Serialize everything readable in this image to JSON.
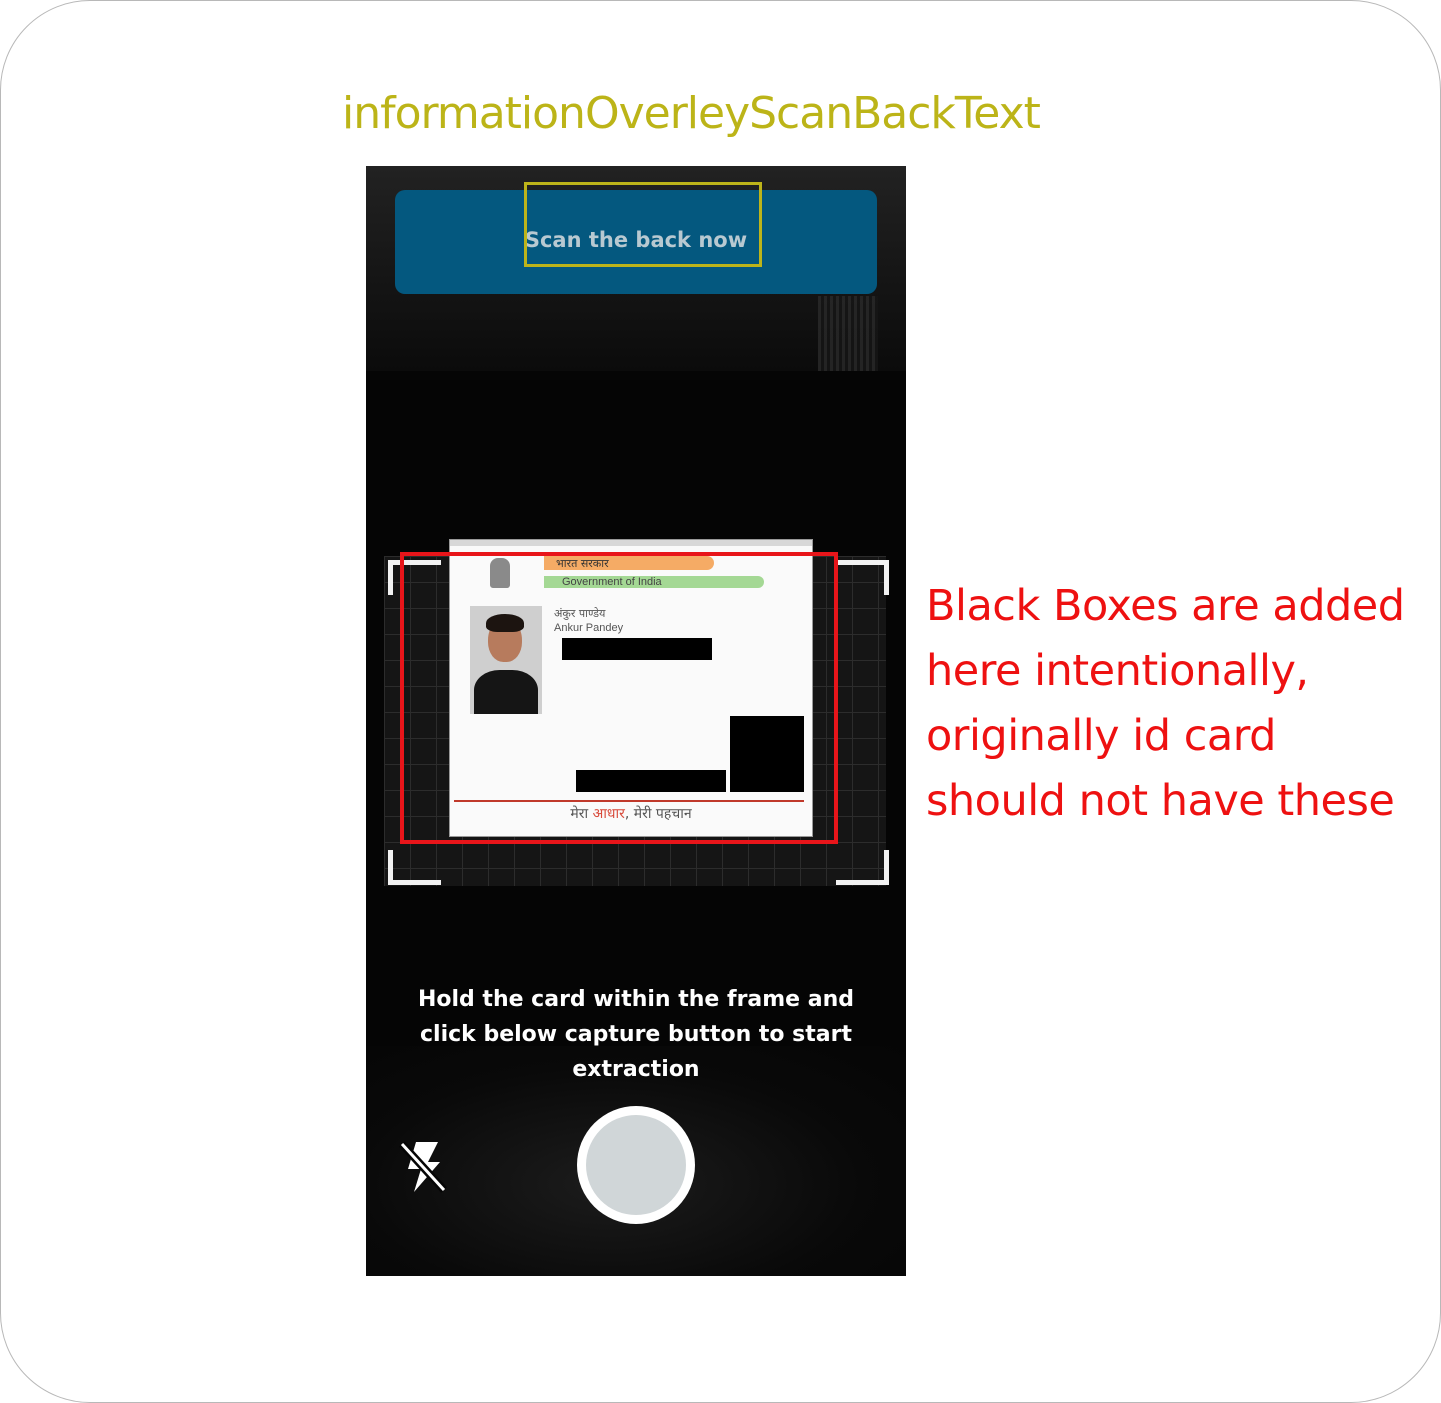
{
  "annotation": {
    "title": "informationOverleyScanBackText",
    "side_note": "Black Boxes are added here intentionally, originally id card should not have these",
    "title_color": "#bcb418",
    "note_color": "#ee1111",
    "highlight_colors": [
      "#bdb41a",
      "#e8151a"
    ]
  },
  "app": {
    "banner_text": "Scan the back now",
    "banner_color": "#04587f",
    "instruction": "Hold the card within the frame and click below capture button to start extraction",
    "flash_icon": "flash-off-icon",
    "capture_icon": "capture-button"
  },
  "card": {
    "header_hindi": "भारत सरकार",
    "header_english": "Government of India",
    "name_hindi": "अंकुर पाण्डेय",
    "name_english": "Ankur Pandey",
    "footer_prefix": "मेरा ",
    "footer_accent": "आधार",
    "footer_suffix": ", मेरी पहचान"
  }
}
